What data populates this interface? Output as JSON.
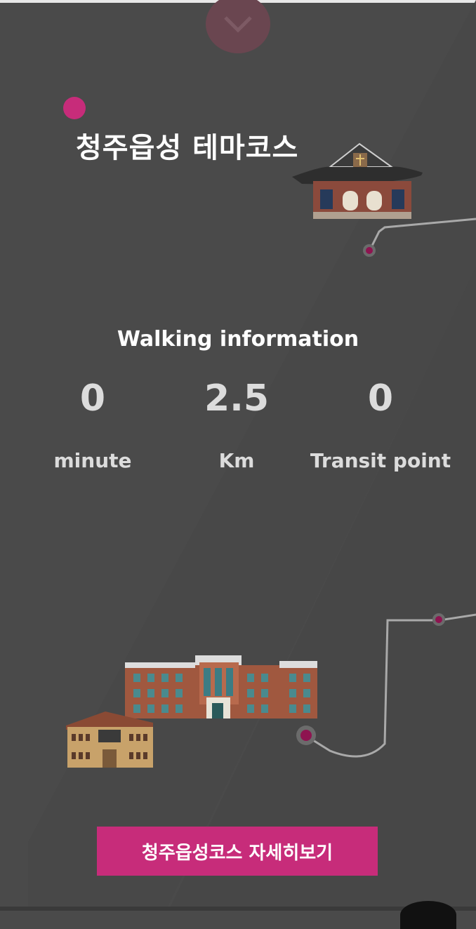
{
  "header": {
    "collapse_icon": "chevron-down-icon",
    "title": "청주읍성 테마코스"
  },
  "walking": {
    "title": "Walking information",
    "stats": [
      {
        "value": "0",
        "label": "minute"
      },
      {
        "value": "2.5",
        "label": "Km"
      },
      {
        "value": "0",
        "label": "Transit point"
      }
    ]
  },
  "cta": {
    "label": "청주읍성코스 자세히보기"
  },
  "colors": {
    "accent": "#c72c7a",
    "background": "#4a4a4a",
    "route": "#b8b8b8"
  },
  "icons": [
    "church-building-icon",
    "school-building-icon",
    "small-building-icon",
    "route-point-icon"
  ]
}
